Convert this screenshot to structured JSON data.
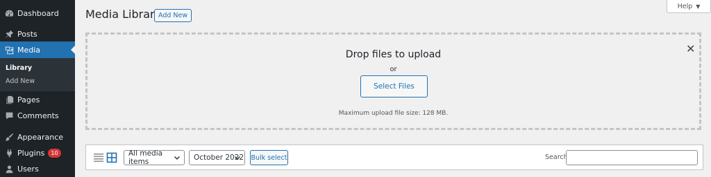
{
  "sidebar": {
    "items": [
      {
        "label": "Dashboard",
        "icon": "dashboard-icon"
      },
      {
        "label": "Posts",
        "icon": "pin-icon"
      },
      {
        "label": "Media",
        "icon": "media-icon",
        "active": true
      },
      {
        "label": "Pages",
        "icon": "pages-icon"
      },
      {
        "label": "Comments",
        "icon": "comment-icon"
      },
      {
        "label": "Appearance",
        "icon": "brush-icon"
      },
      {
        "label": "Plugins",
        "icon": "plug-icon",
        "badge": "10"
      },
      {
        "label": "Users",
        "icon": "user-icon"
      }
    ],
    "submenu": [
      {
        "label": "Library",
        "current": true
      },
      {
        "label": "Add New"
      }
    ]
  },
  "header": {
    "title": "Media Library",
    "add_new_label": "Add New",
    "help_label": "Help"
  },
  "upload": {
    "title": "Drop files to upload",
    "or": "or",
    "button_label": "Select Files",
    "max_size": "Maximum upload file size: 128 MB."
  },
  "toolbar": {
    "type_filter": "All media items",
    "date_filter": "October 2022",
    "bulk_label": "Bulk select",
    "search_label": "Search",
    "search_value": ""
  },
  "colors": {
    "sidebar_bg": "#1d2327",
    "accent": "#2271b1",
    "badge": "#d63638"
  }
}
